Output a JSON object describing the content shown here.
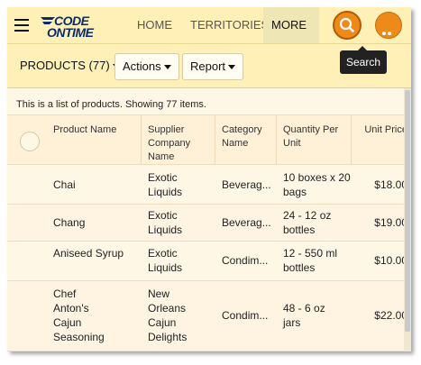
{
  "app": {
    "logo": {
      "line1": "CODE",
      "line2": "ONTIME"
    },
    "nav": {
      "home": "HOME",
      "territories": "TERRITORIES",
      "more": "MORE"
    },
    "tooltip": "Search",
    "colors": {
      "bar": "#fff0b8",
      "accent": "#ee8a1a",
      "background": "#fff7e6"
    }
  },
  "toolbar": {
    "view_label": "PRODUCTS (77)",
    "actions_label": "Actions",
    "report_label": "Report"
  },
  "summary": "This is a list of products. Showing 77 items.",
  "grid": {
    "columns": [
      "Product Name",
      "Supplier Company Name",
      "Category Name",
      "Quantity Per Unit",
      "Unit Price"
    ],
    "rows": [
      {
        "name": "Chai",
        "supplier": "Exotic Liquids",
        "category": "Beverag...",
        "quantity": "10 boxes x 20 bags",
        "price": "$18.00"
      },
      {
        "name": "Chang",
        "supplier": "Exotic Liquids",
        "category": "Beverag...",
        "quantity": "24 - 12 oz bottles",
        "price": "$19.00"
      },
      {
        "name": "Aniseed Syrup",
        "supplier": "Exotic Liquids",
        "category": "Condim...",
        "quantity": "12 - 550 ml bottles",
        "price": "$10.00"
      },
      {
        "name": "Chef Anton's Cajun Seasoning",
        "supplier": "New Orleans Cajun Delights",
        "category": "Condim...",
        "quantity": "48 - 6 oz jars",
        "price": "$22.00"
      }
    ]
  }
}
